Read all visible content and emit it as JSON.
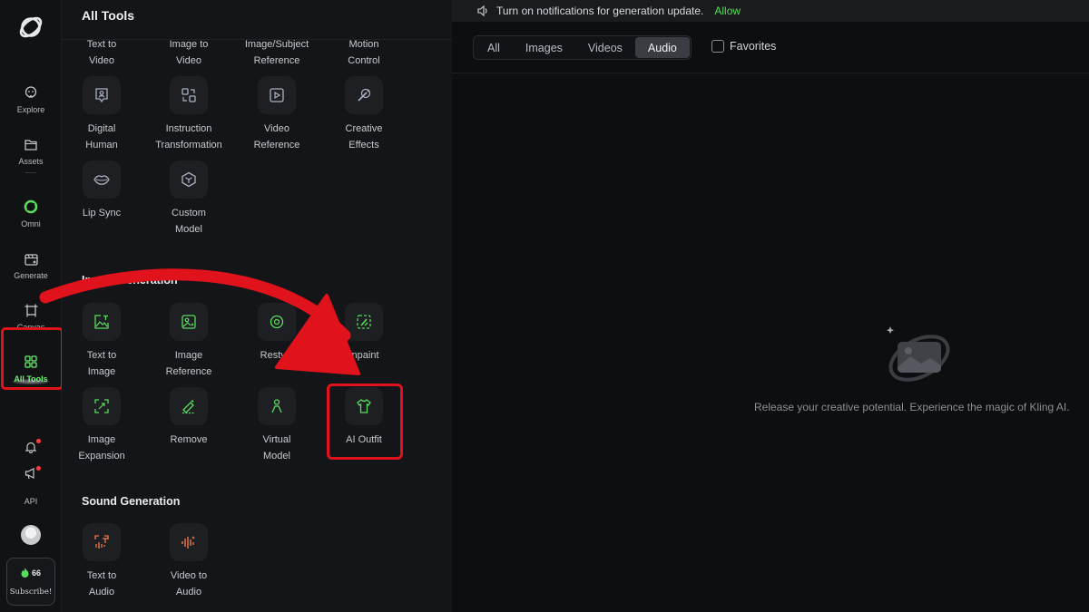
{
  "rail": {
    "items": [
      {
        "label": "Explore"
      },
      {
        "label": "Assets"
      },
      {
        "label": "Omni"
      },
      {
        "label": "Generate"
      },
      {
        "label": "Canvas"
      },
      {
        "label": "All Tools"
      }
    ],
    "api_label": "API",
    "credits": "66",
    "subscribe_label": "Subscribe!"
  },
  "panel": {
    "title": "All Tools",
    "video_tools": [
      {
        "line1": "Text to",
        "line2": "Video"
      },
      {
        "line1": "Image to",
        "line2": "Video"
      },
      {
        "line1": "Image/Subject",
        "line2": "Reference"
      },
      {
        "line1": "Motion",
        "line2": "Control"
      },
      {
        "line1": "Digital",
        "line2": "Human"
      },
      {
        "line1": "Instruction",
        "line2": "Transformation"
      },
      {
        "line1": "Video",
        "line2": "Reference"
      },
      {
        "line1": "Creative",
        "line2": "Effects"
      },
      {
        "line1": "Lip Sync",
        "line2": ""
      },
      {
        "line1": "Custom",
        "line2": "Model"
      }
    ],
    "image_section_title": "Image Generation",
    "image_tools": [
      {
        "line1": "Text to",
        "line2": "Image"
      },
      {
        "line1": "Image",
        "line2": "Reference"
      },
      {
        "line1": "Restyle",
        "line2": ""
      },
      {
        "line1": "Inpaint",
        "line2": ""
      },
      {
        "line1": "Image",
        "line2": "Expansion"
      },
      {
        "line1": "Remove",
        "line2": ""
      },
      {
        "line1": "Virtual",
        "line2": "Model"
      },
      {
        "line1": "AI Outfit",
        "line2": ""
      }
    ],
    "sound_section_title": "Sound Generation",
    "sound_tools": [
      {
        "line1": "Text to",
        "line2": "Audio"
      },
      {
        "line1": "Video to",
        "line2": "Audio"
      }
    ]
  },
  "main": {
    "notification": "Turn on notifications for generation update.",
    "allow_label": "Allow",
    "filters": [
      "All",
      "Images",
      "Videos",
      "Audio"
    ],
    "active_filter": "Audio",
    "favorites_label": "Favorites",
    "empty_message": "Release your creative potential. Experience the magic of Kling AI."
  },
  "colors": {
    "accent_green": "#5bdc5e",
    "highlight_red": "#e0121b",
    "sound_orange": "#f07a4a"
  }
}
